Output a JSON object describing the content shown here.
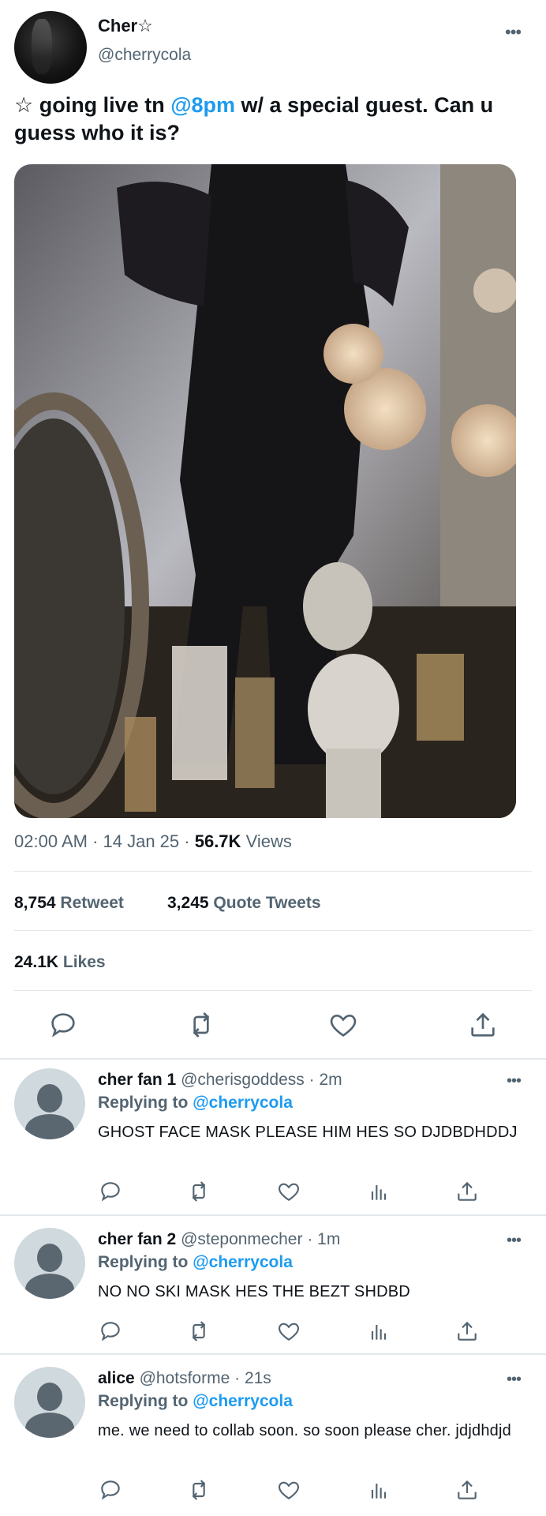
{
  "tweet": {
    "author_name": "Cher☆",
    "author_handle": "@cherrycola",
    "text_prefix": "☆ going live tn ",
    "text_mention": "@8pm",
    "text_suffix": " w/ a special guest. Can u guess who it is?",
    "time": "02:00 AM",
    "date": "14 Jan 25",
    "views_count": "56.7K",
    "views_label": "Views",
    "retweets_count": "8,754",
    "retweets_label": "Retweet",
    "quotes_count": "3,245",
    "quotes_label": "Quote Tweets",
    "likes_count": "24.1K",
    "likes_label": "Likes",
    "more": "•••"
  },
  "actions": [
    "reply-icon",
    "retweet-icon",
    "like-icon",
    "share-icon"
  ],
  "replies": [
    {
      "name": "cher fan 1",
      "handle": "@cherisgoddess",
      "time": "2m",
      "replying_label": "Replying to",
      "replying_to": "@cherrycola",
      "text": "GHOST FACE MASK PLEASE HIM HES SO DJDBDHDDJ"
    },
    {
      "name": "cher fan 2",
      "handle": "@steponmecher",
      "time": "1m",
      "replying_label": "Replying to",
      "replying_to": "@cherrycola",
      "text": "NO NO SKI MASK HES THE BEZT SHDBD"
    },
    {
      "name": "alice",
      "handle": "@hotsforme",
      "time": "21s",
      "replying_label": "Replying to",
      "replying_to": "@cherrycola",
      "text": "me. we need to collab soon. so soon please cher. jdjdhdjd"
    }
  ],
  "colors": {
    "accent": "#1d9bf0",
    "secondary": "#536471",
    "text": "#0f1419",
    "divider": "#e3e7ea"
  }
}
